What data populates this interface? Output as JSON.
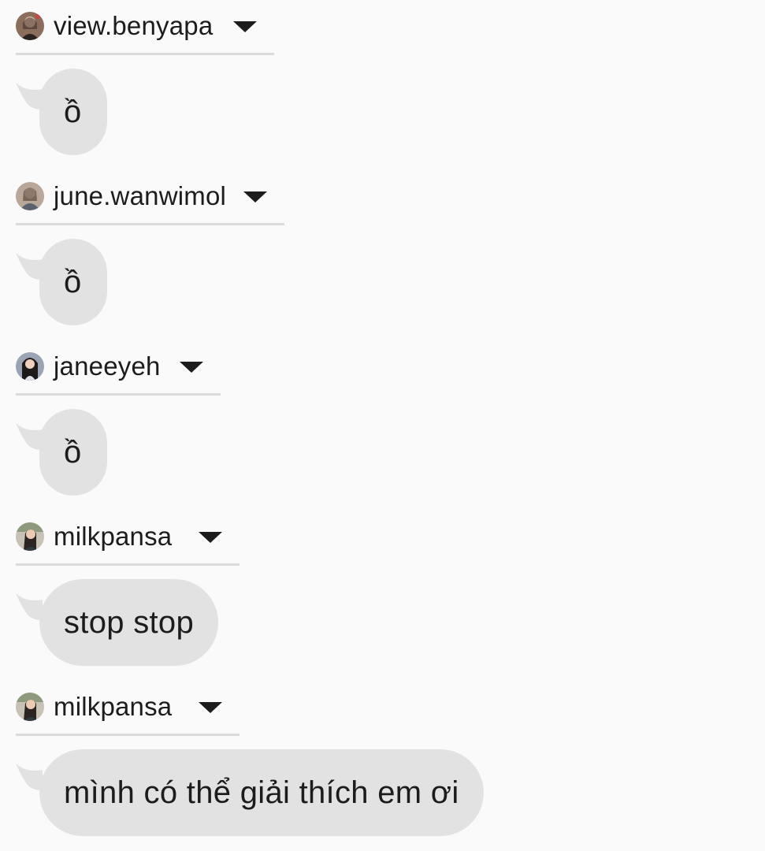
{
  "colors": {
    "background": "#fafafa",
    "bubble": "#e2e2e2",
    "divider": "#dcdcdc",
    "text": "#1c1c1c"
  },
  "messages": [
    {
      "username": "view.benyapa",
      "avatar_icon": "avatar-photo-icon",
      "dropdown_icon": "caret-down-icon",
      "text": "ồ"
    },
    {
      "username": "june.wanwimol",
      "avatar_icon": "avatar-photo-icon",
      "dropdown_icon": "caret-down-icon",
      "text": "ồ"
    },
    {
      "username": "janeeyeh",
      "avatar_icon": "avatar-photo-icon",
      "dropdown_icon": "caret-down-icon",
      "text": "ồ"
    },
    {
      "username": "milkpansa",
      "avatar_icon": "avatar-photo-icon",
      "dropdown_icon": "caret-down-icon",
      "text": "stop stop"
    },
    {
      "username": "milkpansa",
      "avatar_icon": "avatar-photo-icon",
      "dropdown_icon": "caret-down-icon",
      "text": "mình có thể giải thích em ơi"
    }
  ]
}
